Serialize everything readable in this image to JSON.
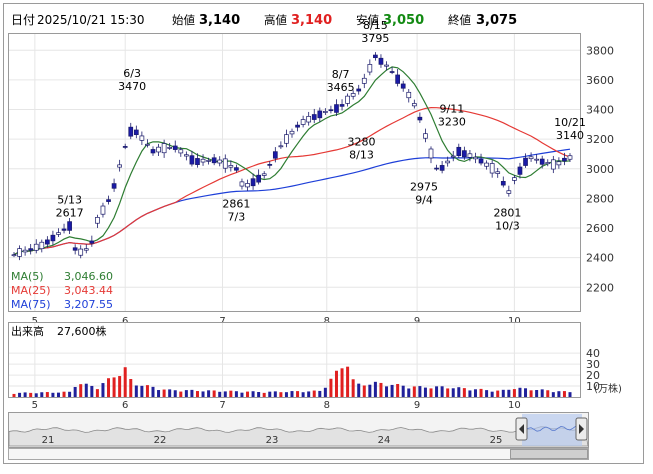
{
  "header": {
    "date_label": "日付",
    "date_value": "2025/10/21 15:30",
    "open_label": "始値",
    "open_value": "3,140",
    "high_label": "高値",
    "high_value": "3,140",
    "low_label": "安値",
    "low_value": "3,050",
    "close_label": "終値",
    "close_value": "3,075"
  },
  "legend": {
    "ma5_label": "MA(5)",
    "ma5_value": "3,046.60",
    "ma25_label": "MA(25)",
    "ma25_value": "3,043.44",
    "ma75_label": "MA(75)",
    "ma75_value": "3,207.55"
  },
  "volume_panel": {
    "label": "出来高",
    "value": "27,600株",
    "unit": "(万株)"
  },
  "navigator": {
    "labels": [
      "21",
      "22",
      "23",
      "24",
      "25"
    ]
  },
  "colors": {
    "up": "#ffffff",
    "down": "#1a1aa6",
    "ma5": "#2e7d32",
    "ma25": "#e53935",
    "ma75": "#1e3fd8",
    "volume_hi": "#e02020",
    "volume": "#20209a"
  },
  "chart_data": {
    "type": "candlestick",
    "price_axis": {
      "ticks": [
        2200,
        2400,
        2600,
        2800,
        3000,
        3200,
        3400,
        3600,
        3800
      ],
      "range": [
        2040,
        3910
      ]
    },
    "volume_axis": {
      "ticks": [
        10,
        20,
        30,
        40
      ],
      "range": [
        0,
        52
      ]
    },
    "month_ticks": [
      {
        "label": "5",
        "day": 3
      },
      {
        "label": "6",
        "day": 16
      },
      {
        "label": "7",
        "day": 30
      },
      {
        "label": "8",
        "day": 45
      },
      {
        "label": "9",
        "day": 58
      },
      {
        "label": "10",
        "day": 72
      }
    ],
    "price_path": [
      {
        "d": 0,
        "v": 2420
      },
      {
        "d": 4,
        "v": 2480
      },
      {
        "d": 8,
        "v": 2617
      },
      {
        "d": 9,
        "v": 2420
      },
      {
        "d": 11,
        "v": 2470
      },
      {
        "d": 12,
        "v": 2650
      },
      {
        "d": 14,
        "v": 2820
      },
      {
        "d": 16,
        "v": 3150
      },
      {
        "d": 17,
        "v": 3280
      },
      {
        "d": 20,
        "v": 3120
      },
      {
        "d": 23,
        "v": 3150
      },
      {
        "d": 26,
        "v": 3050
      },
      {
        "d": 29,
        "v": 3060
      },
      {
        "d": 32,
        "v": 3000
      },
      {
        "d": 33,
        "v": 2870
      },
      {
        "d": 36,
        "v": 2960
      },
      {
        "d": 38,
        "v": 3130
      },
      {
        "d": 41,
        "v": 3300
      },
      {
        "d": 44,
        "v": 3370
      },
      {
        "d": 47,
        "v": 3420
      },
      {
        "d": 50,
        "v": 3550
      },
      {
        "d": 52,
        "v": 3760
      },
      {
        "d": 54,
        "v": 3680
      },
      {
        "d": 56,
        "v": 3560
      },
      {
        "d": 58,
        "v": 3400
      },
      {
        "d": 60,
        "v": 3100
      },
      {
        "d": 61,
        "v": 2980
      },
      {
        "d": 64,
        "v": 3120
      },
      {
        "d": 67,
        "v": 3060
      },
      {
        "d": 70,
        "v": 2960
      },
      {
        "d": 71,
        "v": 2820
      },
      {
        "d": 72,
        "v": 2930
      },
      {
        "d": 74,
        "v": 3080
      },
      {
        "d": 76,
        "v": 3050
      },
      {
        "d": 78,
        "v": 3020
      },
      {
        "d": 79,
        "v": 3060
      },
      {
        "d": 80,
        "v": 3075
      }
    ],
    "volume_path": [
      {
        "d": 0,
        "v": 4
      },
      {
        "d": 8,
        "v": 5
      },
      {
        "d": 9,
        "v": 14
      },
      {
        "d": 12,
        "v": 10
      },
      {
        "d": 16,
        "v": 28
      },
      {
        "d": 17,
        "v": 14
      },
      {
        "d": 22,
        "v": 7
      },
      {
        "d": 30,
        "v": 6
      },
      {
        "d": 36,
        "v": 5
      },
      {
        "d": 44,
        "v": 6
      },
      {
        "d": 48,
        "v": 36
      },
      {
        "d": 49,
        "v": 12
      },
      {
        "d": 52,
        "v": 14
      },
      {
        "d": 58,
        "v": 10
      },
      {
        "d": 62,
        "v": 10
      },
      {
        "d": 70,
        "v": 6
      },
      {
        "d": 72,
        "v": 9
      },
      {
        "d": 80,
        "v": 5
      }
    ],
    "annotations": [
      {
        "date": "5/13",
        "price": "2617",
        "day": 8,
        "value": 2617,
        "pos": "above"
      },
      {
        "date": "6/3",
        "price": "3470",
        "day": 17,
        "value": 3470,
        "pos": "above"
      },
      {
        "date": "7/3",
        "price": "2861",
        "day": 32,
        "value": 2861,
        "pos": "below"
      },
      {
        "date": "8/7",
        "price": "3465",
        "day": 47,
        "value": 3465,
        "pos": "above"
      },
      {
        "date": "8/15",
        "price": "3795",
        "day": 52,
        "value": 3795,
        "pos": "above"
      },
      {
        "date": "8/13",
        "price": "3280",
        "day": 50,
        "value": 3280,
        "pos": "below"
      },
      {
        "date": "9/4",
        "price": "2975",
        "day": 59,
        "value": 2975,
        "pos": "below"
      },
      {
        "date": "9/11",
        "price": "3230",
        "day": 63,
        "value": 3230,
        "pos": "above"
      },
      {
        "date": "10/3",
        "price": "2801",
        "day": 71,
        "value": 2801,
        "pos": "below"
      },
      {
        "date": "10/21",
        "price": "3140",
        "day": 80,
        "value": 3140,
        "pos": "above"
      }
    ]
  }
}
